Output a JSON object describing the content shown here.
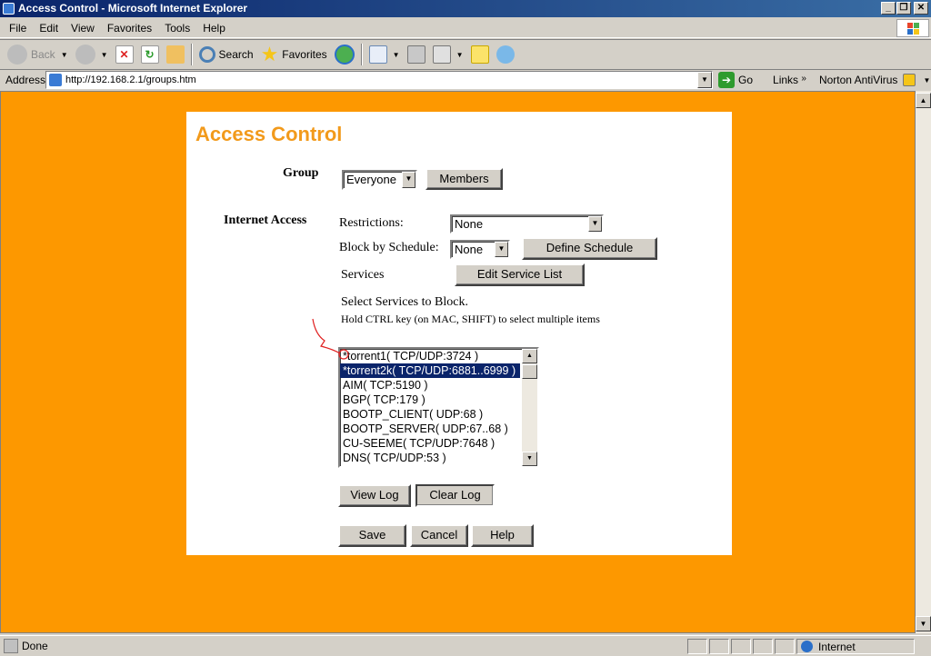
{
  "window": {
    "title": "Access Control - Microsoft Internet Explorer"
  },
  "menu": {
    "items": [
      "File",
      "Edit",
      "View",
      "Favorites",
      "Tools",
      "Help"
    ]
  },
  "toolbar": {
    "back_label": "Back",
    "search_label": "Search",
    "favorites_label": "Favorites"
  },
  "address": {
    "label": "Address",
    "url": "http://192.168.2.1/groups.htm",
    "go_label": "Go",
    "links_label": "Links",
    "norton_label": "Norton AntiVirus"
  },
  "page": {
    "heading": "Access Control",
    "group_label": "Group",
    "group_value": "Everyone",
    "members_button": "Members",
    "internet_access_label": "Internet Access",
    "restrictions_label": "Restrictions:",
    "restrictions_value": "None",
    "block_schedule_label": "Block by Schedule:",
    "block_schedule_value": "None",
    "define_schedule_button": "Define Schedule",
    "services_label": "Services",
    "edit_service_list_button": "Edit Service List",
    "select_services_text": "Select Services to Block.",
    "hold_ctrl_text": "Hold CTRL key (on MAC, SHIFT) to select multiple items",
    "services_list": [
      "*torrent1( TCP/UDP:3724 )",
      "*torrent2k( TCP/UDP:6881..6999 )",
      "AIM( TCP:5190 )",
      "BGP( TCP:179 )",
      "BOOTP_CLIENT( UDP:68 )",
      "BOOTP_SERVER( UDP:67..68 )",
      "CU-SEEME( TCP/UDP:7648 )",
      "DNS( TCP/UDP:53 )"
    ],
    "selected_service_index": 1,
    "view_log_button": "View Log",
    "clear_log_button": "Clear Log",
    "save_button": "Save",
    "cancel_button": "Cancel",
    "help_button": "Help"
  },
  "status": {
    "text": "Done",
    "zone": "Internet"
  },
  "colors": {
    "page_background": "#fd9800",
    "heading": "#f29a1b",
    "selection": "#0a246a"
  }
}
